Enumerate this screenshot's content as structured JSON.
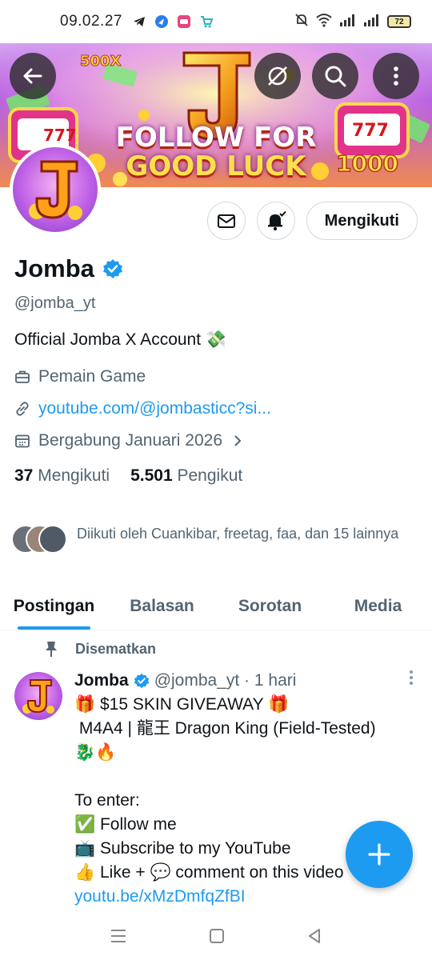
{
  "status_bar": {
    "time": "09.02.27",
    "battery": "72"
  },
  "banner": {
    "line1": "FOLLOW FOR",
    "line2": "GOOD LUCK",
    "badge_left": "500X",
    "badge_right": "1000",
    "slot_left": "777",
    "slot_right": "777",
    "logo_letter": "J"
  },
  "actions": {
    "follow_label": "Mengikuti"
  },
  "profile": {
    "name": "Jomba",
    "handle": "@jomba_yt",
    "bio": "Official Jomba X Account 💸",
    "category": "Pemain Game",
    "link": "youtube.com/@jombasticc?si...",
    "joined": "Bergabung Januari 2026",
    "following_count": "37",
    "following_label": "Mengikuti",
    "followers_count": "5.501",
    "followers_label": "Pengikut",
    "followed_by": "Diikuti oleh Cuankibar, freetag, faa, dan 15 lainnya"
  },
  "tabs": [
    "Postingan",
    "Balasan",
    "Sorotan",
    "Media"
  ],
  "post": {
    "pinned_label": "Disematkan",
    "author": "Jomba",
    "handle_time": "@jomba_yt · 1 hari",
    "lines": [
      "🎁 $15 SKIN GIVEAWAY 🎁",
      " M4A4 | 龍王 Dragon King (Field-Tested)",
      "🐉🔥",
      "",
      "To enter:",
      "✅ Follow me",
      "📺 Subscribe to my YouTube",
      "👍 Like + 💬 comment on this video"
    ],
    "link": "youtu.be/xMzDmfqZfBI"
  },
  "colors": {
    "accent": "#1d9bf0",
    "text": "#0f1419",
    "secondary": "#536471"
  }
}
